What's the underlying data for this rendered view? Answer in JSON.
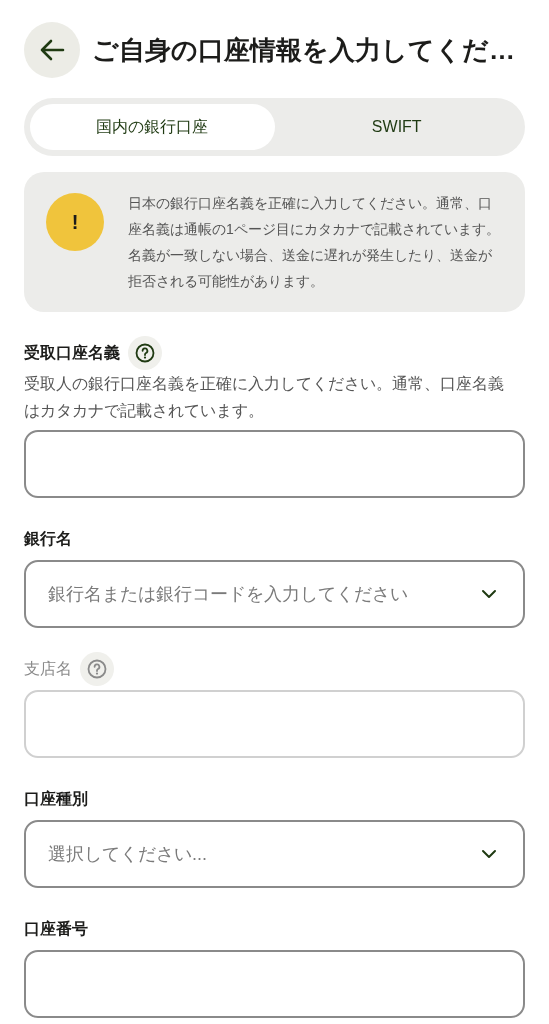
{
  "header": {
    "title": "ご自身の口座情報を入力してくだ…"
  },
  "tabs": [
    {
      "label": "国内の銀行口座",
      "selected": true
    },
    {
      "label": "SWIFT",
      "selected": false
    }
  ],
  "notice": {
    "icon": "!",
    "text": "日本の銀行口座名義を正確に入力してください。通常、口座名義は通帳の1ページ目にカタカナで記載されています。名義が一致しない場合、送金に遅れが発生したり、送金が拒否される可能性があります。"
  },
  "fields": [
    {
      "kind": "text",
      "label": "受取口座名義",
      "help": true,
      "disabled": false,
      "description": "受取人の銀行口座名義を正確に入力してください。通常、口座名義はカタカナで記載されています。"
    },
    {
      "kind": "select",
      "label": "銀行名",
      "help": false,
      "disabled": false,
      "placeholder": "銀行名または銀行コードを入力してください"
    },
    {
      "kind": "text",
      "label": "支店名",
      "help": true,
      "disabled": true
    },
    {
      "kind": "select",
      "label": "口座種別",
      "help": false,
      "disabled": false,
      "placeholder": "選択してください..."
    },
    {
      "kind": "text",
      "label": "口座番号",
      "help": false,
      "disabled": false
    }
  ]
}
